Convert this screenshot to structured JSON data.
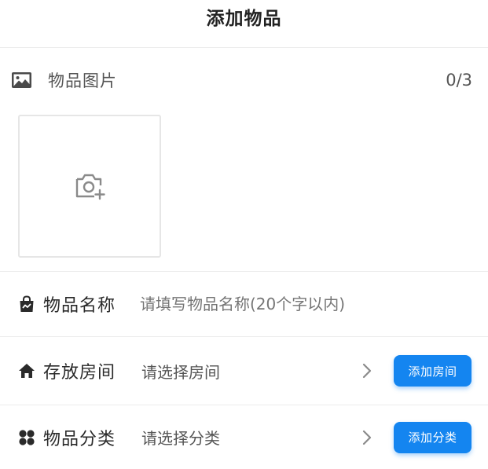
{
  "header": {
    "title": "添加物品"
  },
  "image_section": {
    "label": "物品图片",
    "count": "0/3",
    "icon": "image-icon",
    "upload_icon": "camera-add-icon"
  },
  "form": {
    "name": {
      "label": "物品名称",
      "placeholder": "请填写物品名称(20个字以内)",
      "value": "",
      "icon": "bag-icon"
    },
    "room": {
      "label": "存放房间",
      "value": "请选择房间",
      "button_label": "添加房间",
      "icon": "home-icon"
    },
    "category": {
      "label": "物品分类",
      "value": "请选择分类",
      "button_label": "添加分类",
      "icon": "category-icon"
    }
  },
  "colors": {
    "accent": "#1485f0",
    "text_primary": "#222222",
    "text_placeholder": "#9a9a9a",
    "divider": "#ececec"
  }
}
